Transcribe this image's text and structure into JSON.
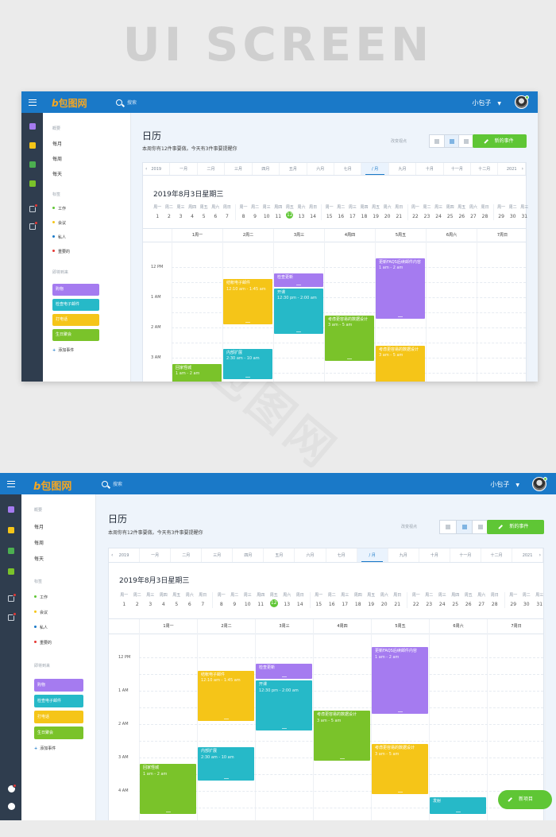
{
  "hero_title": "UI SCREEN",
  "app": {
    "logo": "包图网",
    "logo_mark": "b",
    "search_placeholder": "搜索",
    "user_name": "小包子"
  },
  "sidebar": {
    "overview_header": "概要",
    "views": [
      "每月",
      "每周",
      "每天"
    ],
    "tags_header": "标签",
    "tags": [
      {
        "label": "工作",
        "color": "#5fc635"
      },
      {
        "label": "会议",
        "color": "#f5c518"
      },
      {
        "label": "私人",
        "color": "#1a79c8"
      },
      {
        "label": "重要的",
        "color": "#e53935"
      }
    ],
    "todo_header": "即将到来",
    "todos": [
      {
        "label": "购物",
        "color": "#a57bf0"
      },
      {
        "label": "检查电子邮件",
        "color": "#26b9c8"
      },
      {
        "label": "打电话",
        "color": "#f5c518"
      },
      {
        "label": "生日聚会",
        "color": "#7ac32a"
      }
    ],
    "add_event": "添加事件"
  },
  "main": {
    "title": "日历",
    "subtitle": "本周你有12件事要做。今天有3件事要提醒你",
    "view_label": "改变视点",
    "new_event": "新的事件",
    "months": [
      "2019",
      "一月",
      "二月",
      "三月",
      "四月",
      "五月",
      "六月",
      "七月",
      "/ 月",
      "九月",
      "十月",
      "十一月",
      "十二月",
      "2021"
    ],
    "active_month": 8,
    "date_heading": "2019年8月3日星期三",
    "weekday_names": [
      "周一",
      "周二",
      "周三",
      "周四",
      "周五",
      "周六",
      "周日"
    ],
    "weeks": [
      [
        1,
        2,
        3,
        4,
        5,
        6,
        7
      ],
      [
        8,
        9,
        10,
        11,
        12,
        13,
        14
      ],
      [
        15,
        16,
        17,
        18,
        19,
        20,
        21
      ],
      [
        22,
        23,
        24,
        25,
        26,
        27,
        28
      ],
      [
        29,
        30,
        31
      ]
    ],
    "selected_day": 12,
    "day_columns": [
      "1周一",
      "2周二",
      "3周三",
      "4周四",
      "5周五",
      "6周六",
      "7周日"
    ],
    "time_labels": [
      "12 PM",
      "1 AM",
      "2 AM",
      "3 AM",
      "4 AM"
    ],
    "events": [
      {
        "title": "结帐电子邮件",
        "time": "12:10 am - 1:45 am",
        "color": "#f5c518",
        "day": 1,
        "start": 0.4,
        "end": 1.9
      },
      {
        "title": "检查更新",
        "time": "",
        "color": "#a57bf0",
        "day": 2,
        "start": 0.2,
        "end": 0.65
      },
      {
        "title": "开课",
        "time": "12:30 pm - 2:00 am",
        "color": "#26b9c8",
        "day": 2,
        "start": 0.7,
        "end": 2.2
      },
      {
        "title": "考虑更容易的数据设计",
        "time": "3 am - 5 am",
        "color": "#7ac32a",
        "day": 3,
        "start": 1.6,
        "end": 3.1
      },
      {
        "title": "更新FAQS后续邮件内容",
        "time": "1 am - 2 am",
        "color": "#a57bf0",
        "day": 4,
        "start": -0.3,
        "end": 1.7
      },
      {
        "title": "内部扩展",
        "time": "2:30 am - 10 am",
        "color": "#26b9c8",
        "day": 1,
        "start": 2.7,
        "end": 3.7
      },
      {
        "title": "回家怪城",
        "time": "1 am - 2 am",
        "color": "#7ac32a",
        "day": 0,
        "start": 3.2,
        "end": 4.7
      },
      {
        "title": "考虑更容易的数据设计",
        "time": "3 am - 5 am",
        "color": "#f5c518",
        "day": 4,
        "start": 2.6,
        "end": 4.1
      },
      {
        "title": "发射",
        "time": "",
        "color": "#26b9c8",
        "day": 5,
        "start": 4.2,
        "end": 4.7
      }
    ],
    "fab_label": "新项目"
  },
  "watermark": "包图网"
}
